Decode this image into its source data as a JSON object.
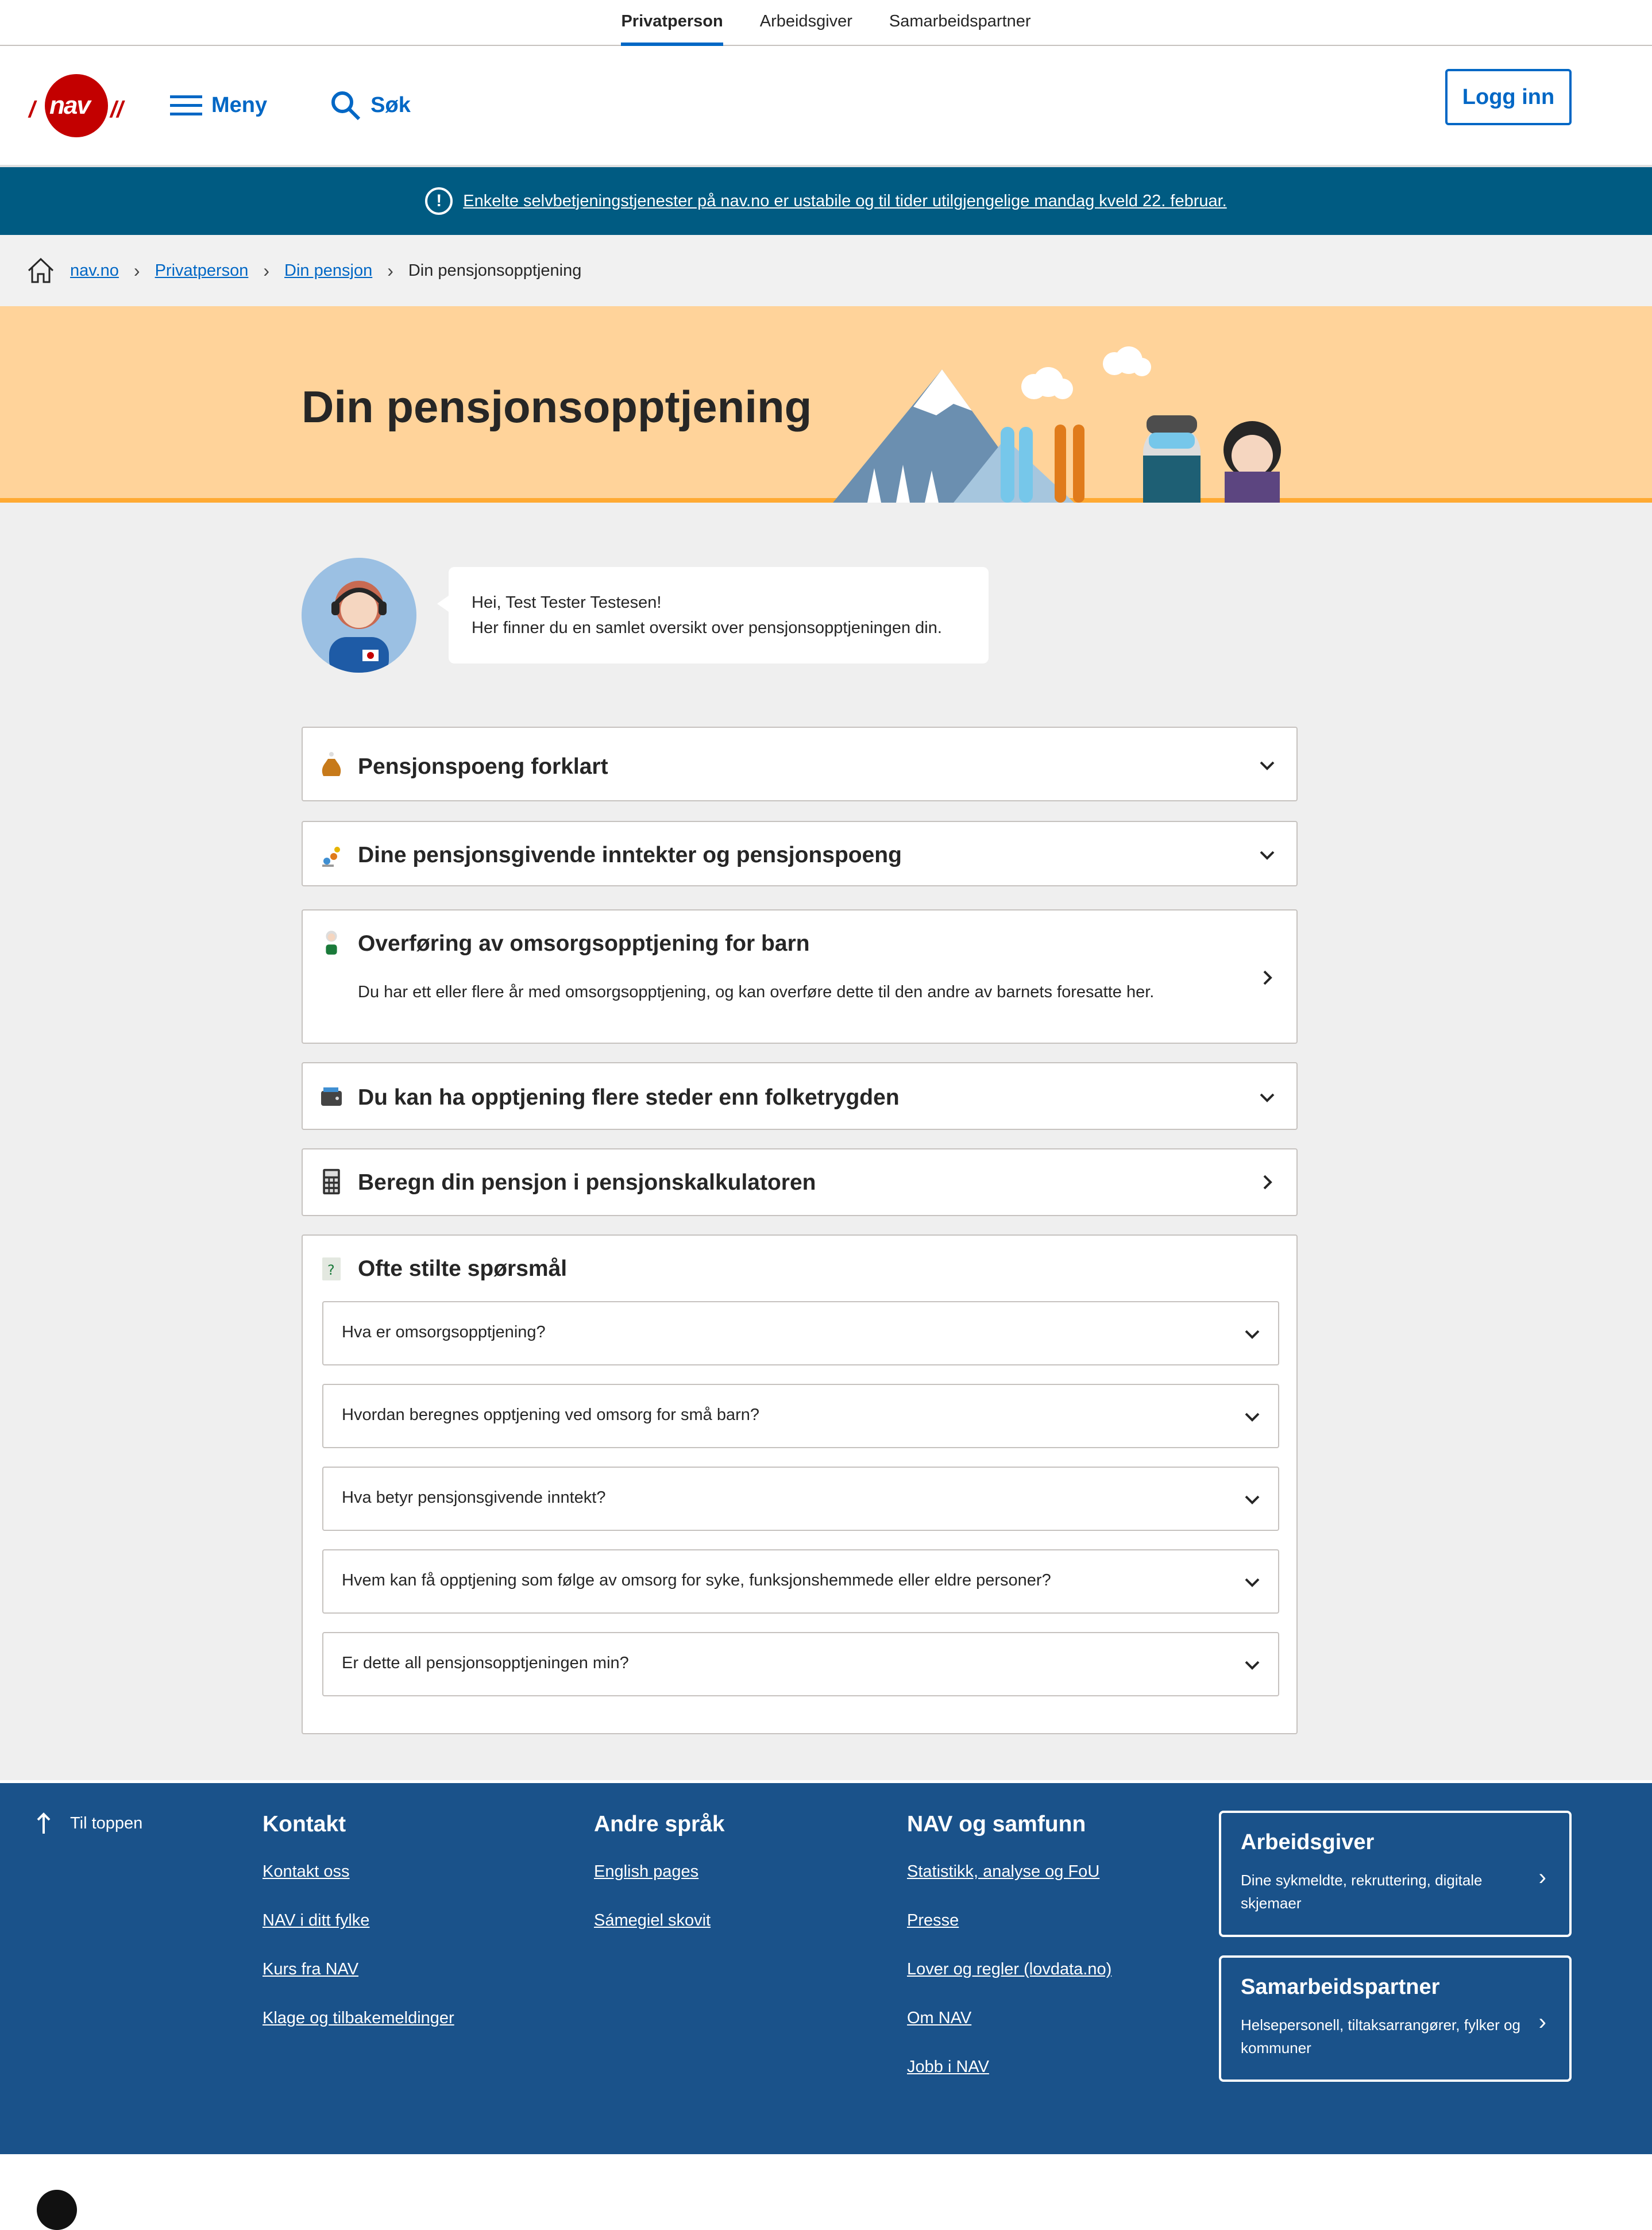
{
  "topnav": {
    "tabs": [
      {
        "label": "Privatperson"
      },
      {
        "label": "Arbeidsgiver"
      },
      {
        "label": "Samarbeidspartner"
      }
    ]
  },
  "header": {
    "logo_text": "nav",
    "menu_label": "Meny",
    "search_label": "Søk",
    "login_label": "Logg inn"
  },
  "alert": {
    "text": "Enkelte selvbetjeningstjenester på nav.no er ustabile og til tider utilgjengelige mandag kveld 22. februar.",
    "icon": "exclamation-icon"
  },
  "breadcrumb": {
    "items": [
      "nav.no",
      "Privatperson",
      "Din pensjon"
    ],
    "current": "Din pensjonsopptjening"
  },
  "hero": {
    "title": "Din pensjonsopptjening"
  },
  "greeting": {
    "line1": "Hei, Test Tester Testesen!",
    "line2": "Her finner du en samlet oversikt over pensjonsopptjeningen din."
  },
  "panels": [
    {
      "title": "Pensjonspoeng forklart",
      "icon": "money-bag-icon"
    },
    {
      "title": "Dine pensjonsgivende inntekter og pensjonspoeng",
      "icon": "coins-icon"
    },
    {
      "title": "Overføring av omsorgsopptjening for barn",
      "icon": "grandparent-icon",
      "description": "Du har ett eller flere år med omsorgsopptjening, og kan overføre dette til den andre av barnets foresatte her."
    },
    {
      "title": "Du kan ha opptjening flere steder enn folketrygden",
      "icon": "wallet-icon"
    },
    {
      "title": "Beregn din pensjon i pensjonskalkulatoren",
      "icon": "calculator-icon"
    }
  ],
  "faq": {
    "title": "Ofte stilte spørsmål",
    "icon": "question-note-icon",
    "questions": [
      "Hva er omsorgsopptjening?",
      "Hvordan beregnes opptjening ved omsorg for små barn?",
      "Hva betyr pensjonsgivende inntekt?",
      "Hvem kan få opptjening som følge av omsorg for syke, funksjonshemmede eller eldre personer?",
      "Er dette all pensjonsopptjeningen min?"
    ]
  },
  "footer": {
    "to_top": "Til toppen",
    "kontakt": {
      "heading": "Kontakt",
      "links": [
        "Kontakt oss",
        "NAV i ditt fylke",
        "Kurs fra NAV",
        "Klage og tilbakemeldinger"
      ]
    },
    "sprak": {
      "heading": "Andre språk",
      "links": [
        "English pages",
        "Sámegiel skovit"
      ]
    },
    "samfunn": {
      "heading": "NAV og samfunn",
      "links": [
        "Statistikk, analyse og FoU",
        "Presse",
        "Lover og regler (lovdata.no)",
        "Om NAV",
        "Jobb i NAV"
      ]
    },
    "cards": [
      {
        "title": "Arbeidsgiver",
        "desc": "Dine sykmeldte, rekruttering, digitale skjemaer"
      },
      {
        "title": "Samarbeidspartner",
        "desc": "Helsepersonell, tiltaksarrangører, fylker og kommuner"
      }
    ]
  },
  "colors": {
    "brand_red": "#c30000",
    "action_blue": "#0067c5",
    "alert_bg": "#005b82",
    "hero_bg": "#ffd39a",
    "footer_bg": "#1a528a"
  }
}
